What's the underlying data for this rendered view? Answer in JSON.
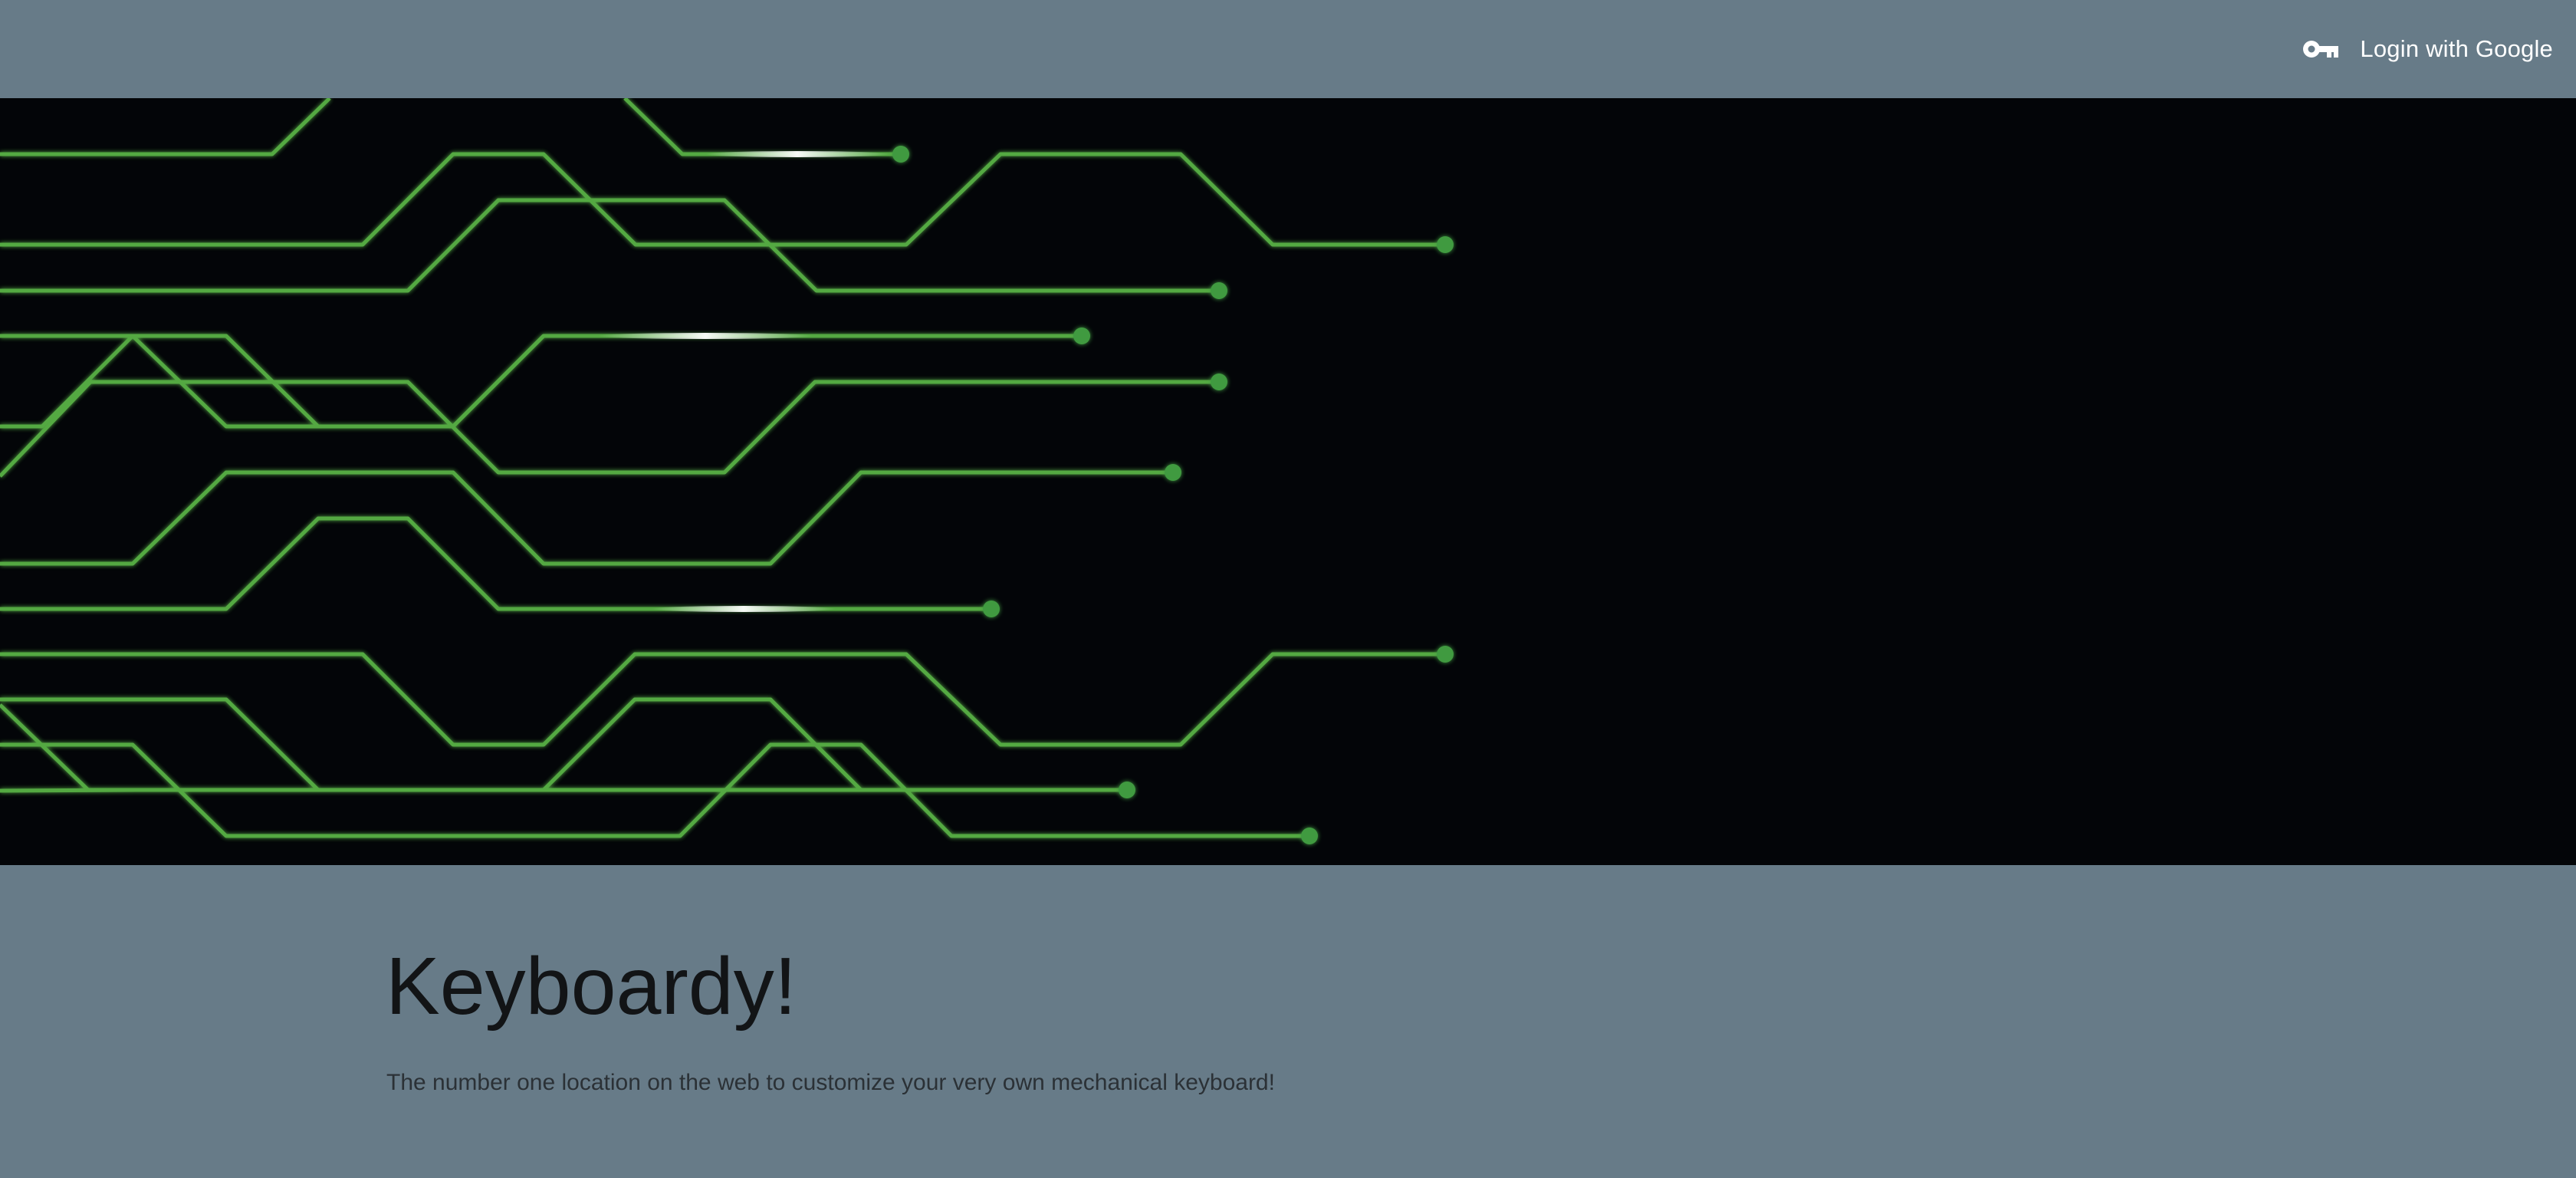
{
  "navbar": {
    "login_label": "Login with Google",
    "login_icon": "key-icon"
  },
  "hero": {
    "image": "green-circuit-lines-banner",
    "line_color": "#5dbb4a",
    "background_color": "#030508"
  },
  "main": {
    "title": "Keyboardy!",
    "tagline": "The number one location on the web to customize your very own mechanical keyboard!"
  },
  "colors": {
    "page_background": "#677b88",
    "title": "#121416",
    "tagline": "#2b3136",
    "nav_text": "#ffffff"
  }
}
